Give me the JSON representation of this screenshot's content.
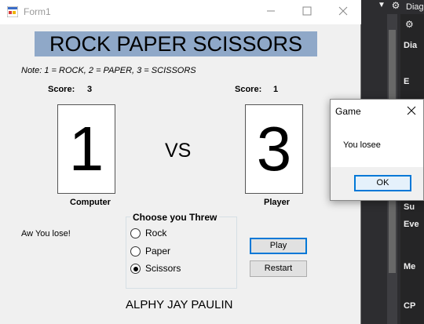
{
  "ide": {
    "panel_title": "Diag",
    "panel_rows": [
      "Dia",
      "E",
      "Su",
      "Eve",
      "Me",
      "CP"
    ]
  },
  "window": {
    "title": "Form1",
    "minimize_icon": "minimize-icon",
    "maximize_icon": "maximize-icon",
    "close_icon": "close-icon"
  },
  "game": {
    "heading": "ROCK PAPER SCISSORS",
    "heading_bg": "#8fa8c8",
    "note": "Note: 1 = ROCK, 2 = PAPER, 3 = SCISSORS",
    "computer": {
      "score_label": "Score:",
      "score": "3",
      "choice": "1",
      "label": "Computer"
    },
    "player": {
      "score_label": "Score:",
      "score": "1",
      "choice": "3",
      "label": "Player"
    },
    "vs": "VS",
    "result": "Aw You lose!",
    "choose": {
      "title": "Choose you Threw",
      "options": [
        "Rock",
        "Paper",
        "Scissors"
      ],
      "selected": "Scissors"
    },
    "play_label": "Play",
    "restart_label": "Restart",
    "author": "ALPHY JAY PAULIN"
  },
  "dialog": {
    "title": "Game",
    "message": "You losee",
    "ok_label": "OK",
    "accent": "#0078d7"
  }
}
